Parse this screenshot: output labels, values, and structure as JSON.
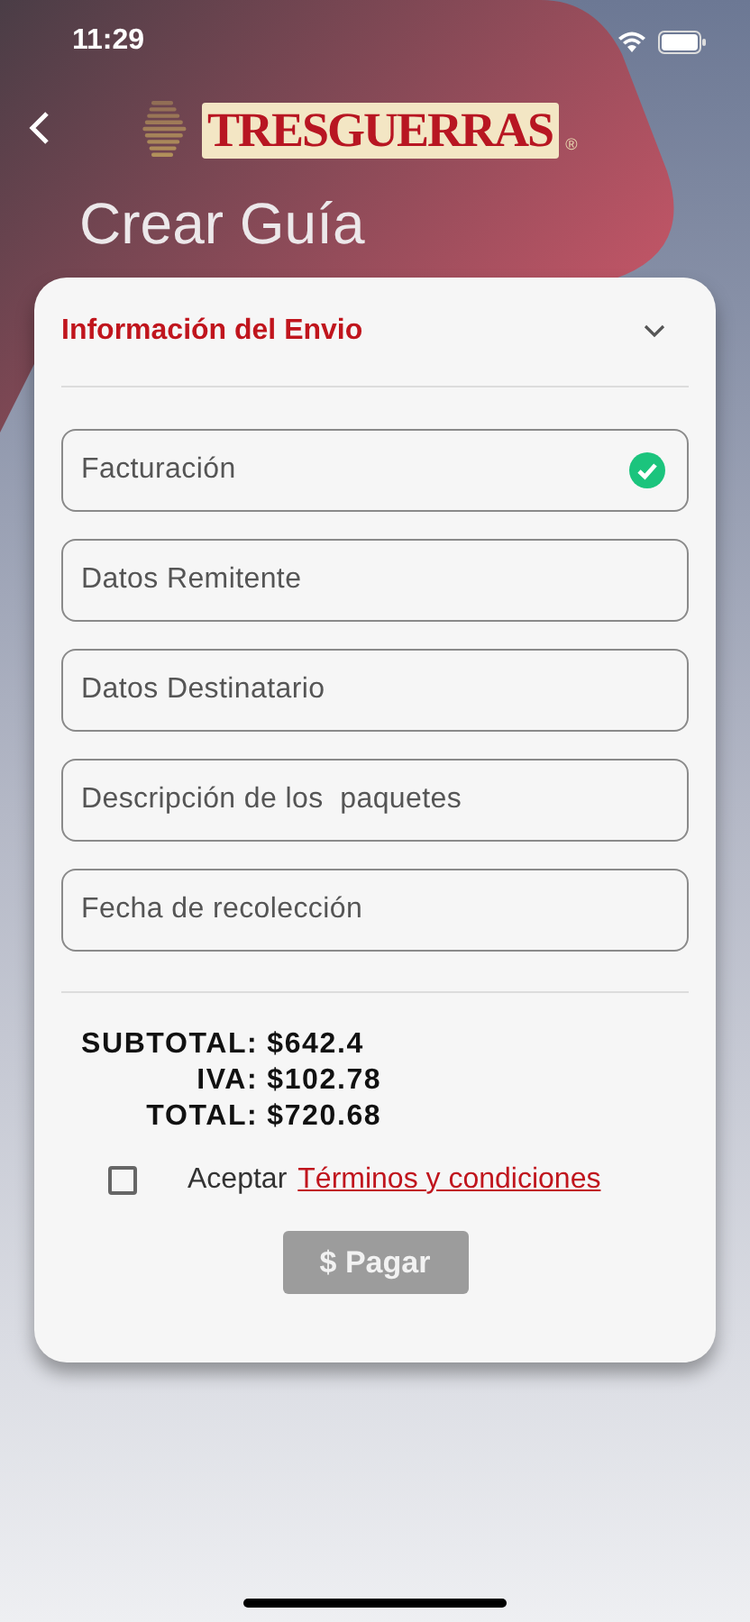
{
  "status_bar": {
    "time": "11:29"
  },
  "header": {
    "logo_text": "TRESGUERRAS",
    "logo_mark": "®",
    "title": "Crear Guía"
  },
  "card": {
    "section_title": "Información del Envio",
    "expanded": true,
    "fields": [
      {
        "label": "Facturación",
        "completed": true
      },
      {
        "label": "Datos Remitente",
        "completed": false
      },
      {
        "label": "Datos Destinatario",
        "completed": false
      },
      {
        "label": "Descripción de los  paquetes",
        "completed": false
      },
      {
        "label": "Fecha de recolección",
        "completed": false
      }
    ],
    "totals": [
      {
        "label": "SUBTOTAL:",
        "value": "$642.4"
      },
      {
        "label": "IVA:",
        "value": "$102.78"
      },
      {
        "label": "TOTAL:",
        "value": "$720.68"
      }
    ],
    "terms": {
      "checked": false,
      "text": "Aceptar",
      "link": "Términos y condiciones"
    },
    "pay_button": {
      "symbol": "$",
      "label": "Pagar",
      "disabled": true
    }
  }
}
